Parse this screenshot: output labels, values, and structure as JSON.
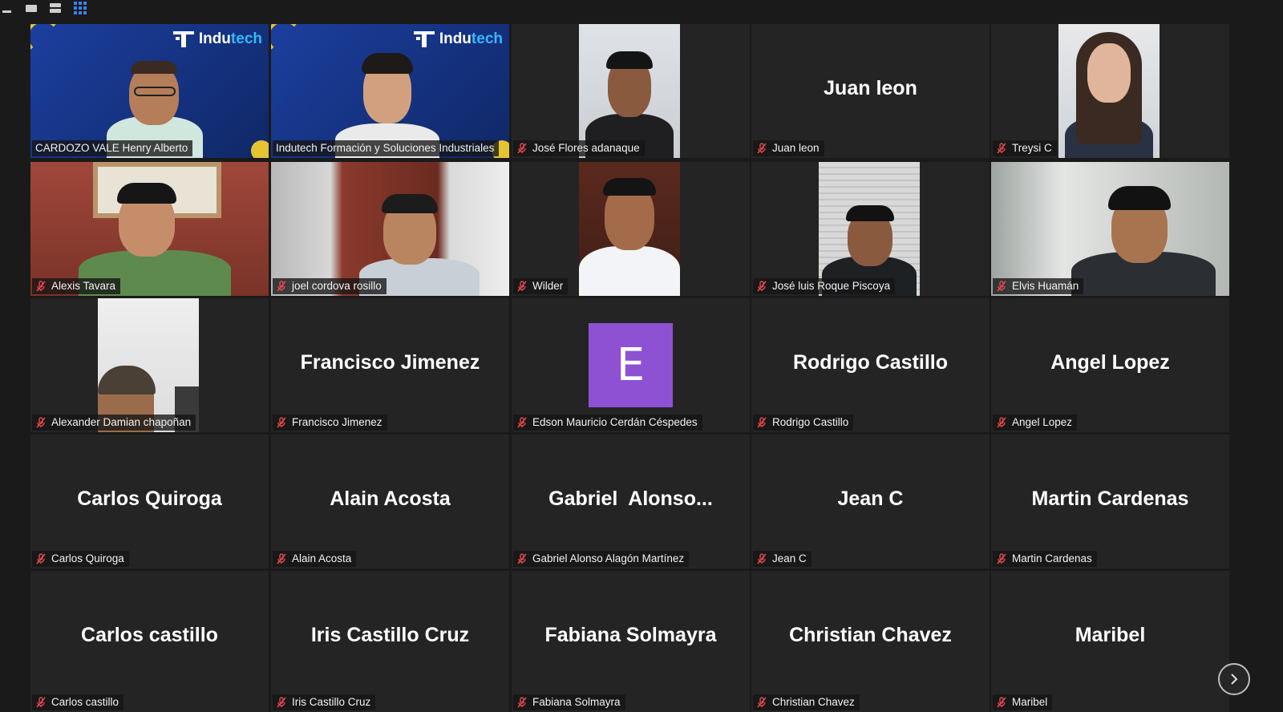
{
  "view_controls": {
    "minimize_icon": "minus-icon",
    "speaker_view_icon": "single-view-icon",
    "strip_view_icon": "strip-view-icon",
    "gallery_view_icon": "grid-view-icon"
  },
  "brand": {
    "logo_part1": "Indu",
    "logo_part2": "tech"
  },
  "participants": [
    {
      "display_name": "CARDOZO VALE Henry Alberto",
      "big_name": "",
      "muted": false,
      "video": true
    },
    {
      "display_name": "Indutech Formación y Soluciones Industriales",
      "big_name": "",
      "muted": false,
      "video": true
    },
    {
      "display_name": "José Flores adanaque",
      "big_name": "",
      "muted": true,
      "video": true
    },
    {
      "display_name": "Juan leon",
      "big_name": "Juan leon",
      "muted": true,
      "video": false
    },
    {
      "display_name": "Treysi C",
      "big_name": "",
      "muted": true,
      "video": true
    },
    {
      "display_name": "Alexis Tavara",
      "big_name": "",
      "muted": true,
      "video": true
    },
    {
      "display_name": "joel cordova rosillo",
      "big_name": "",
      "muted": true,
      "video": true
    },
    {
      "display_name": "Wilder",
      "big_name": "",
      "muted": true,
      "video": true
    },
    {
      "display_name": "José luis Roque Piscoya",
      "big_name": "",
      "muted": true,
      "video": true
    },
    {
      "display_name": "Elvis Huamán",
      "big_name": "",
      "muted": true,
      "video": true
    },
    {
      "display_name": "Alexander Damian chapoñan",
      "big_name": "",
      "muted": true,
      "video": true
    },
    {
      "display_name": "Francisco Jimenez",
      "big_name": "Francisco Jimenez",
      "muted": true,
      "video": false
    },
    {
      "display_name": "Edson Mauricio Cerdán Céspedes",
      "big_name": "",
      "avatar_letter": "E",
      "avatar_color": "#8e51d4",
      "muted": true,
      "video": false
    },
    {
      "display_name": "Rodrigo Castillo",
      "big_name": "Rodrigo Castillo",
      "muted": true,
      "video": false
    },
    {
      "display_name": "Angel Lopez",
      "big_name": "Angel Lopez",
      "muted": true,
      "video": false
    },
    {
      "display_name": "Carlos Quiroga",
      "big_name": "Carlos Quiroga",
      "muted": true,
      "video": false
    },
    {
      "display_name": "Alain Acosta",
      "big_name": "Alain Acosta",
      "muted": true,
      "video": false
    },
    {
      "display_name": "Gabriel Alonso Alagón Martínez",
      "big_name": "Gabriel  Alonso...",
      "muted": true,
      "video": false
    },
    {
      "display_name": "Jean C",
      "big_name": "Jean C",
      "muted": true,
      "video": false
    },
    {
      "display_name": "Martin Cardenas",
      "big_name": "Martin Cardenas",
      "muted": true,
      "video": false
    },
    {
      "display_name": "Carlos castillo",
      "big_name": "Carlos castillo",
      "muted": true,
      "video": false
    },
    {
      "display_name": "Iris Castillo Cruz",
      "big_name": "Iris Castillo Cruz",
      "muted": true,
      "video": false
    },
    {
      "display_name": "Fabiana Solmayra",
      "big_name": "Fabiana Solmayra",
      "muted": true,
      "video": false
    },
    {
      "display_name": "Christian Chavez",
      "big_name": "Christian Chavez",
      "muted": true,
      "video": false
    },
    {
      "display_name": "Maribel",
      "big_name": "Maribel",
      "muted": true,
      "video": false
    }
  ],
  "pagination": {
    "next_icon": "chevron-right-icon"
  },
  "colors": {
    "active_speaker": "#c8d97a",
    "muted_red": "#e5484d",
    "grid_accent": "#3b82f6",
    "tile_bg": "#242424"
  }
}
